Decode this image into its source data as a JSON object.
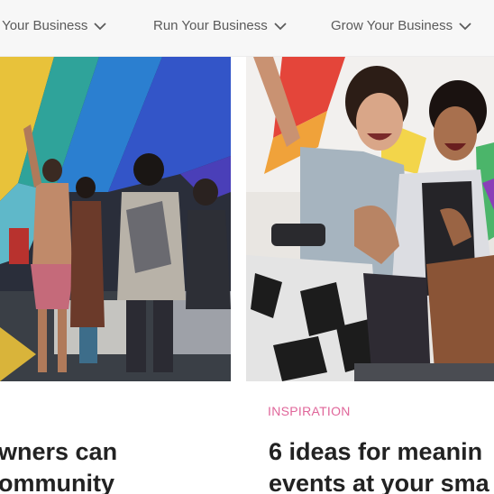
{
  "nav": {
    "items": [
      {
        "label": "t Your Business"
      },
      {
        "label": "Run Your Business"
      },
      {
        "label": "Grow Your Business"
      }
    ]
  },
  "cards": [
    {
      "category": "",
      "headline_lines": [
        "wners can",
        "ommunity"
      ]
    },
    {
      "category": "INSPIRATION",
      "headline_lines": [
        "6 ideas for meanin",
        "events at your sma"
      ]
    }
  ],
  "colors": {
    "category": "#e0669a",
    "nav_bg": "#f7f7f7",
    "headline": "#222222"
  },
  "icons": {
    "nav_chevron": "chevron-down-icon"
  }
}
